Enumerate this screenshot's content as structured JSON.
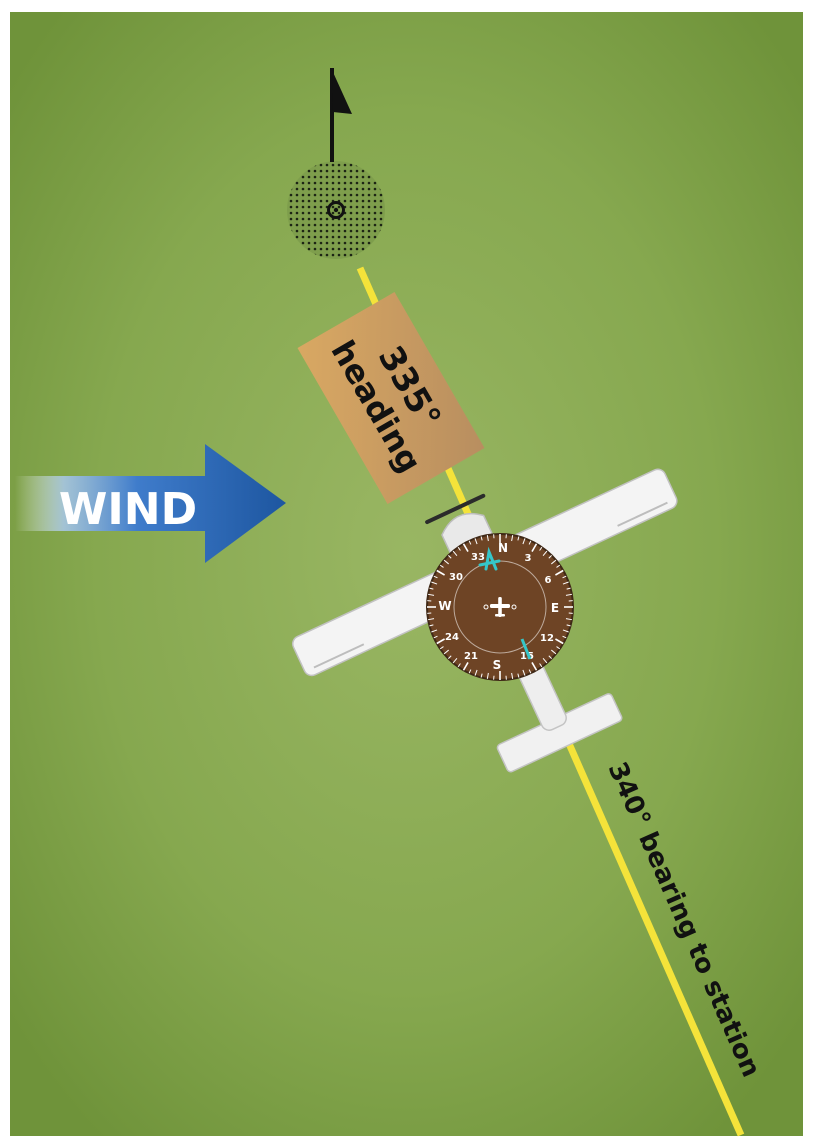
{
  "heading_box": {
    "value": "335°",
    "label": "heading"
  },
  "wind_arrow": {
    "label": "WIND"
  },
  "bearing_line": {
    "label": "340° bearing to station"
  },
  "compass": {
    "cardinals": [
      "N",
      "E",
      "S",
      "W"
    ],
    "numbers": [
      "3",
      "6",
      "12",
      "15",
      "21",
      "24",
      "30",
      "33"
    ]
  },
  "colors": {
    "background_light": "#98b560",
    "background_dark": "#70953c",
    "bearing_line": "#f4e33a",
    "wind_arrow": "#1f5aa3",
    "heading_box": "#c79d5f",
    "compass_face": "#6e4425",
    "compass_markers": "#35c6c9",
    "aircraft": "#f2f2f2"
  }
}
